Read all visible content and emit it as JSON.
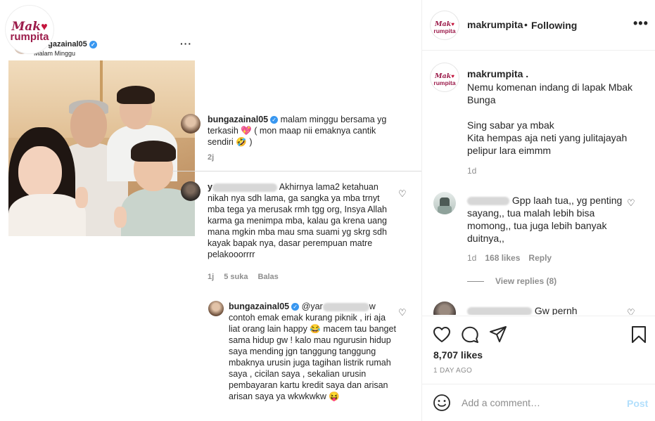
{
  "image": {
    "inner_post": {
      "username": "bungazainal05",
      "location": "Malam Minggu"
    },
    "inner_comments": [
      {
        "username": "bungazainal05",
        "text": "malam minggu bersama yg terkasih 💖 ( mon maap nii emaknya cantik sendiri 🤣 )",
        "time": "2j"
      },
      {
        "username_visible": "y",
        "text_line1": "Akhirnya lama2",
        "text": "ketahuan nikah nya sdh lama, ga sangka ya mba trnyt mba tega ya merusak rmh tgg org, Insya Allah karma ga menimpa mba, kalau ga krena uang mana mgkin mba mau sma suami yg skrg sdh kayak bapak nya, dasar perempuan matre pelakooorrrr",
        "time": "1j",
        "likes": "5 suka",
        "reply": "Balas"
      },
      {
        "username": "bungazainal05",
        "mention_start": "@yar",
        "mention_end": "w",
        "text": "contoh emak emak kurang piknik , iri aja liat orang lain happy 😂 macem tau banget sama hidup gw ! kalo mau ngurusin hidup saya mending jgn tanggung tanggung mbaknya urusin juga tagihan listrik rumah saya , cicilan saya , sekalian urusin pembayaran kartu kredit saya dan arisan arisan saya ya wkwkwkw 😝"
      }
    ]
  },
  "header": {
    "username": "makrumpita",
    "separator": "•",
    "following": "Following",
    "more": "•••"
  },
  "logo": {
    "top": "Mak",
    "bottom": "rumpita"
  },
  "caption": {
    "username": "makrumpita .",
    "text": "Nemu komenan indang di lapak Mbak Bunga\n\nSing sabar ya mbak\nKita hempas aja neti yang julitajayah pelipur lara eimmm",
    "time": "1d"
  },
  "comments": [
    {
      "text": "Gpp laah tua,, yg penting sayang,, tua malah lebih bisa momong,, tua juga lebih banyak duitnya,,",
      "time": "1d",
      "likes": "168 likes",
      "reply": "Reply"
    },
    {
      "text": "Gw pernh"
    }
  ],
  "view_replies": "View replies (8)",
  "likes": "8,707 likes",
  "date": "1 DAY AGO",
  "add_comment": {
    "placeholder": "Add a comment…",
    "post": "Post"
  },
  "colors": {
    "brand": "#9c1c4b",
    "verified": "#3897f0",
    "post_disabled": "#b2dffc",
    "secondary_text": "#8e8e8e"
  }
}
